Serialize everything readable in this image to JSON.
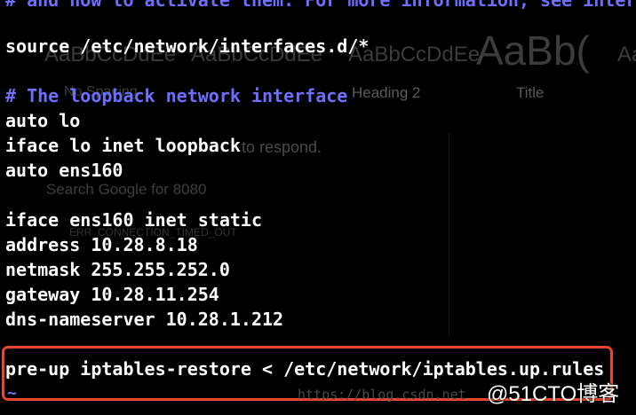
{
  "colors": {
    "background": "#000000",
    "text": "#ffffff",
    "comment": "#6f6fff",
    "highlight_box": "#e8452c"
  },
  "background_ghost": {
    "style_preview_1": "AaBbCcDdEe",
    "style_preview_2": "AaBbCcDdEe",
    "style_preview_3": "AaBbCcDdEe",
    "style_preview_big": "AaBb(",
    "style_preview_edge": "Aa",
    "heading_2_label": "Heading 2",
    "title_label": "Title",
    "normal_label": "No Spacing",
    "respond_text": "to respond.",
    "search_text": "Search Google for 8080",
    "error_text": "ERR_CONNECTION_TIMED_OUT"
  },
  "terminal": {
    "top_comment": "# and how to activate them. For more information, see inter",
    "source_line": "source /etc/network/interfaces.d/*",
    "loopback_comment": "# The loopback network interface",
    "auto_lo": "auto lo",
    "iface_lo": "iface lo inet loopback",
    "auto_ens": "auto ens160",
    "iface_ens": "iface ens160 inet static",
    "address": "address 10.28.8.18",
    "netmask": "netmask 255.255.252.0",
    "gateway": "gateway 10.28.11.254",
    "dns": "dns-nameserver 10.28.1.212",
    "pre_up": "pre-up iptables-restore < /etc/network/iptables.up.rules",
    "tilde": "~"
  },
  "watermark": {
    "url": "https://blog.csdn.net",
    "brand": "@51CTO博客"
  }
}
